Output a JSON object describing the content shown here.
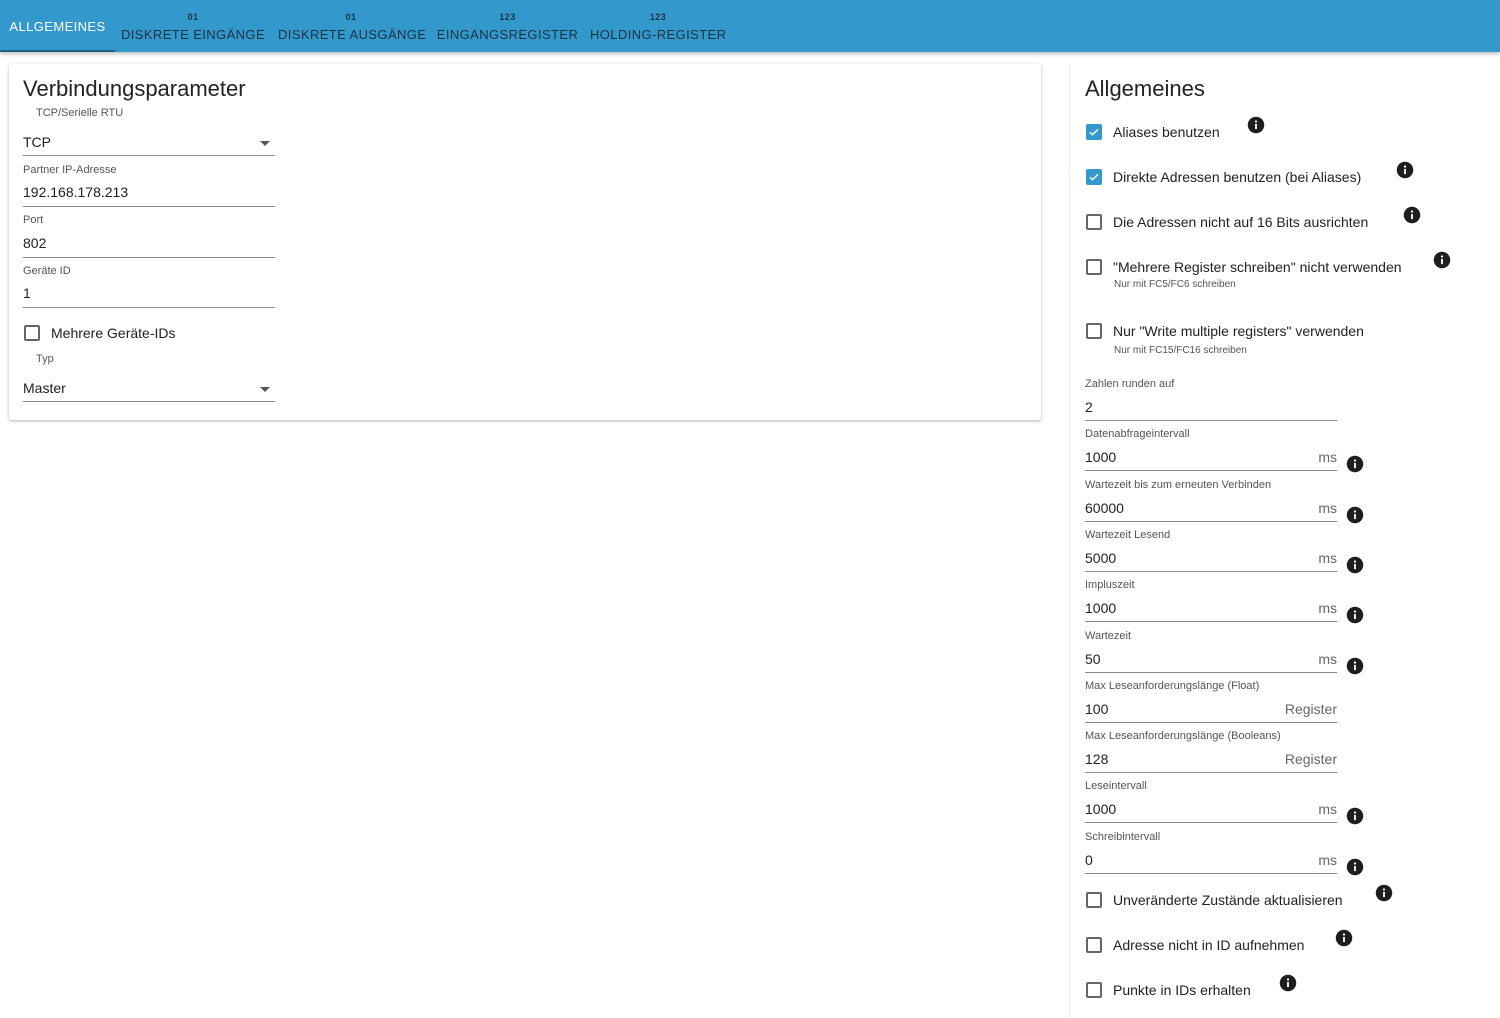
{
  "tabs": [
    {
      "icon": "",
      "label": "ALLGEMEINES",
      "active": true
    },
    {
      "icon": "01",
      "label": "DISKRETE EINGÄNGE"
    },
    {
      "icon": "01",
      "label": "DISKRETE AUSGÄNGE"
    },
    {
      "icon": "123",
      "label": "EINGANGSREGISTER"
    },
    {
      "icon": "123",
      "label": "HOLDING-REGISTER"
    }
  ],
  "connection": {
    "title": "Verbindungsparameter",
    "mode_label": "TCP/Serielle RTU",
    "mode_value": "TCP",
    "ip_label": "Partner IP-Adresse",
    "ip_value": "192.168.178.213",
    "port_label": "Port",
    "port_value": "802",
    "device_id_label": "Geräte ID",
    "device_id_value": "1",
    "multi_ids_label": "Mehrere Geräte-IDs",
    "multi_ids_checked": false,
    "type_label": "Typ",
    "type_value": "Master"
  },
  "general": {
    "title": "Allgemeines",
    "checkboxes": [
      {
        "label": "Aliases benutzen",
        "checked": true,
        "helper": ""
      },
      {
        "label": "Direkte Adressen benutzen (bei Aliases)",
        "checked": true,
        "helper": ""
      },
      {
        "label": "Die Adressen nicht auf 16 Bits ausrichten",
        "checked": false,
        "helper": ""
      },
      {
        "label": "\"Mehrere Register schreiben\" nicht verwenden",
        "checked": false,
        "helper": "Nur mit FC5/FC6 schreiben"
      },
      {
        "label": "Nur \"Write multiple registers\" verwenden",
        "checked": false,
        "helper": "Nur mit FC15/FC16 schreiben"
      }
    ],
    "fields": [
      {
        "label": "Zahlen runden auf",
        "value": "2",
        "unit": ""
      },
      {
        "label": "Datenabfrageintervall",
        "value": "1000",
        "unit": "ms"
      },
      {
        "label": "Wartezeit bis zum erneuten Verbinden",
        "value": "60000",
        "unit": "ms"
      },
      {
        "label": "Wartezeit Lesend",
        "value": "5000",
        "unit": "ms"
      },
      {
        "label": "Impluszeit",
        "value": "1000",
        "unit": "ms"
      },
      {
        "label": "Wartezeit",
        "value": "50",
        "unit": "ms"
      },
      {
        "label": "Max Leseanforderungslänge (Float)",
        "value": "100",
        "unit": "Register"
      },
      {
        "label": "Max Leseanforderungslänge (Booleans)",
        "value": "128",
        "unit": "Register"
      },
      {
        "label": "Leseintervall",
        "value": "1000",
        "unit": "ms"
      },
      {
        "label": "Schreibintervall",
        "value": "0",
        "unit": "ms"
      }
    ],
    "bottom_checkboxes": [
      {
        "label": "Unveränderte Zustände aktualisieren",
        "checked": false
      },
      {
        "label": "Adresse nicht in ID aufnehmen",
        "checked": false
      },
      {
        "label": "Punkte in IDs erhalten",
        "checked": false
      }
    ]
  },
  "colors": {
    "primary": "#3399cc",
    "tab_text": "#17323f",
    "active_tab_text": "#ffffff"
  }
}
